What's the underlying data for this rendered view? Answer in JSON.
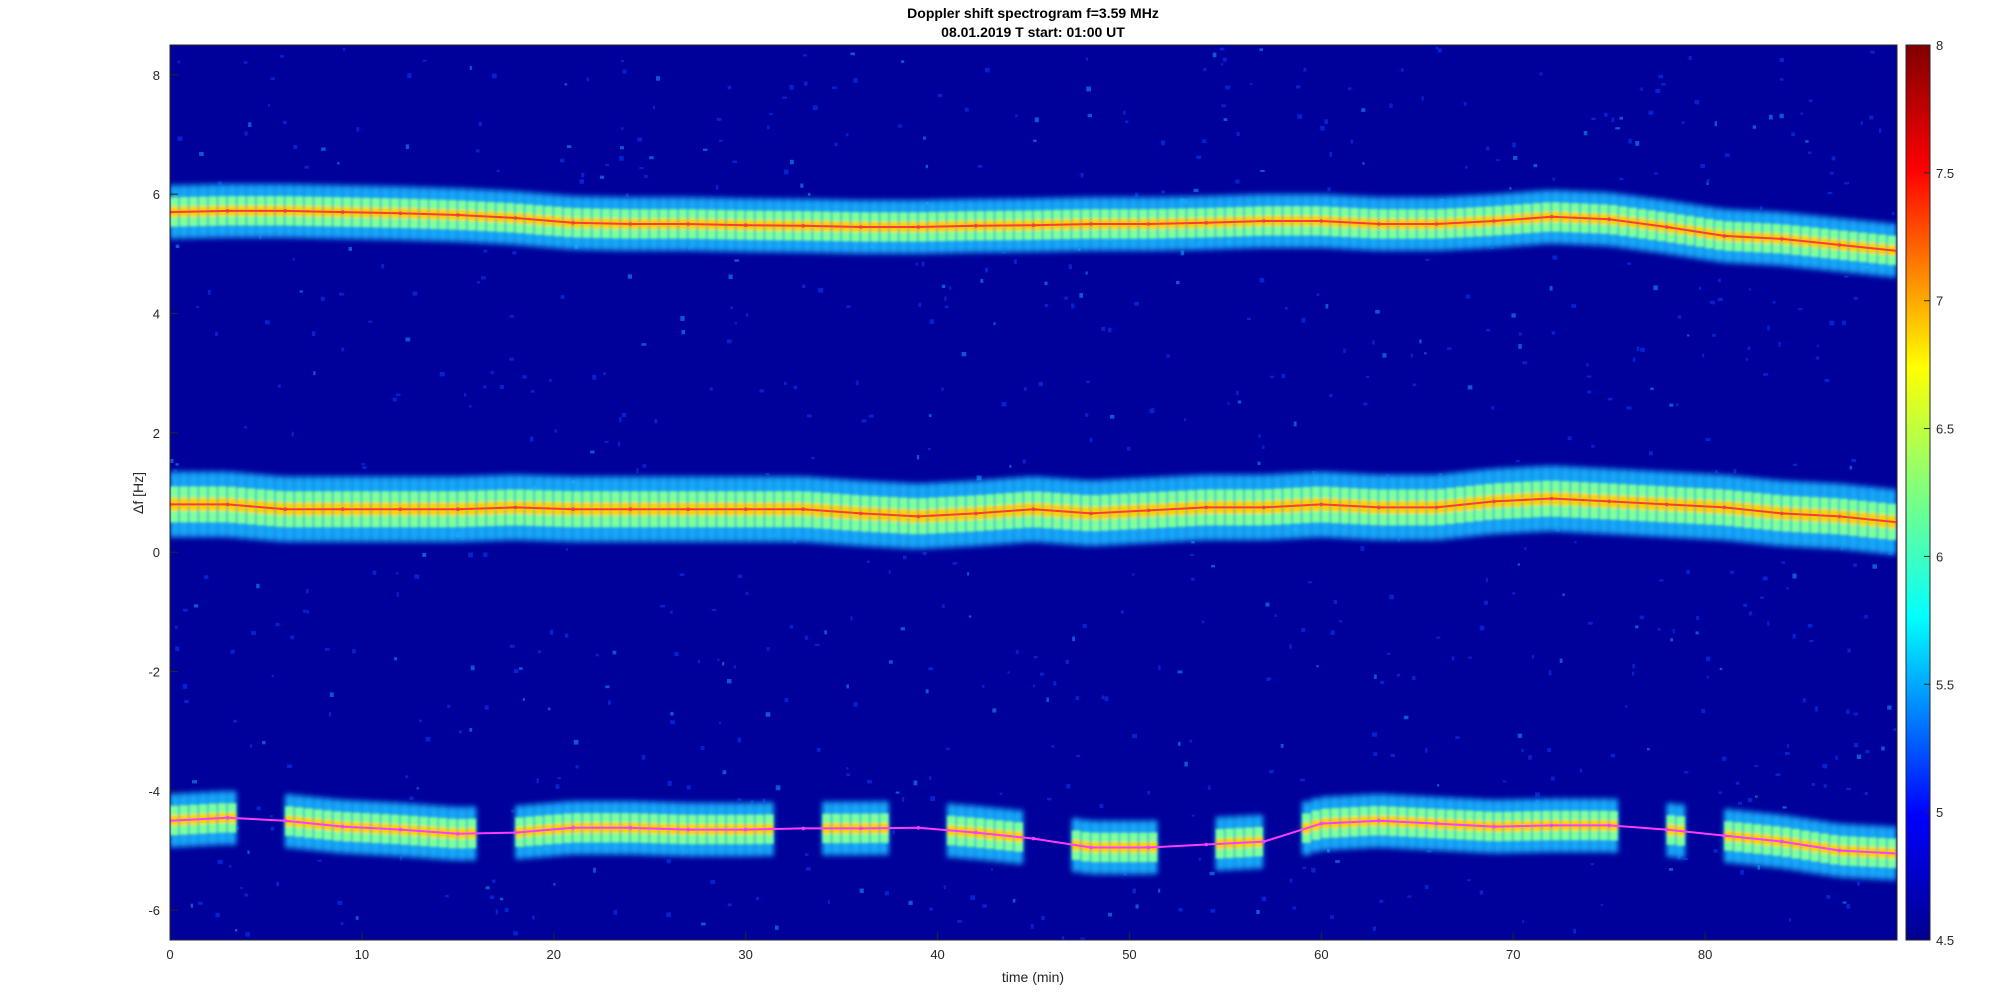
{
  "chart_data": {
    "type": "heatmap",
    "title": "Doppler shift spectrogram f=3.59 MHz",
    "subtitle": "08.01.2019   T start: 01:00 UT",
    "xlabel": "time (min)",
    "ylabel": "Δf [Hz]",
    "xlim": [
      0,
      90
    ],
    "ylim": [
      -6.5,
      8.5
    ],
    "x_ticks": [
      0,
      10,
      20,
      30,
      40,
      50,
      60,
      70,
      80
    ],
    "y_ticks": [
      8,
      6,
      4,
      2,
      0,
      -2,
      -4,
      -6
    ],
    "colormap": "jet",
    "colorbar": {
      "range": [
        4.5,
        8
      ],
      "ticks": [
        "8",
        "7.5",
        "7",
        "6.5",
        "6",
        "5.5",
        "5",
        "4.5"
      ]
    },
    "series": [
      {
        "name": "",
        "band": "upper",
        "color": "#ff3a3a",
        "x": [
          0,
          3,
          6,
          9,
          12,
          15,
          18,
          21,
          24,
          27,
          30,
          33,
          36,
          39,
          42,
          45,
          48,
          51,
          54,
          57,
          60,
          63,
          66,
          69,
          72,
          75,
          78,
          81,
          84,
          87,
          90
        ],
        "y": [
          5.7,
          5.72,
          5.72,
          5.7,
          5.68,
          5.65,
          5.6,
          5.52,
          5.5,
          5.5,
          5.48,
          5.47,
          5.45,
          5.45,
          5.47,
          5.48,
          5.5,
          5.5,
          5.52,
          5.55,
          5.55,
          5.5,
          5.5,
          5.55,
          5.62,
          5.58,
          5.45,
          5.3,
          5.25,
          5.15,
          5.05
        ]
      },
      {
        "name": "",
        "band": "middle",
        "color": "#ff3a3a",
        "x": [
          0,
          3,
          6,
          9,
          12,
          15,
          18,
          21,
          24,
          27,
          30,
          33,
          36,
          39,
          42,
          45,
          48,
          51,
          54,
          57,
          60,
          63,
          66,
          69,
          72,
          75,
          78,
          81,
          84,
          87,
          90
        ],
        "y": [
          0.8,
          0.8,
          0.72,
          0.72,
          0.72,
          0.72,
          0.75,
          0.72,
          0.72,
          0.72,
          0.72,
          0.72,
          0.65,
          0.6,
          0.65,
          0.72,
          0.65,
          0.7,
          0.75,
          0.75,
          0.8,
          0.75,
          0.75,
          0.85,
          0.9,
          0.85,
          0.8,
          0.75,
          0.65,
          0.6,
          0.5
        ]
      },
      {
        "name": "",
        "band": "lower",
        "color": "#ff3cff",
        "x": [
          0,
          3,
          6,
          9,
          12,
          15,
          18,
          21,
          24,
          27,
          30,
          33,
          36,
          39,
          42,
          45,
          48,
          51,
          54,
          57,
          60,
          63,
          66,
          69,
          72,
          75,
          78,
          81,
          84,
          87,
          90
        ],
        "y": [
          -4.5,
          -4.45,
          -4.5,
          -4.6,
          -4.65,
          -4.72,
          -4.7,
          -4.62,
          -4.62,
          -4.65,
          -4.65,
          -4.63,
          -4.63,
          -4.62,
          -4.7,
          -4.8,
          -4.95,
          -4.95,
          -4.9,
          -4.85,
          -4.55,
          -4.5,
          -4.55,
          -4.6,
          -4.58,
          -4.58,
          -4.65,
          -4.75,
          -4.85,
          -5.0,
          -5.05
        ]
      }
    ],
    "data_gaps_min": [
      [
        3.5,
        6.0
      ],
      [
        15.8,
        18.2
      ],
      [
        31.6,
        34.2
      ],
      [
        37.3,
        40.5
      ],
      [
        44.3,
        47.2
      ],
      [
        51.7,
        54.3
      ],
      [
        57.0,
        59.2
      ],
      [
        75.5,
        77.8
      ],
      [
        79.0,
        81.1
      ]
    ]
  }
}
